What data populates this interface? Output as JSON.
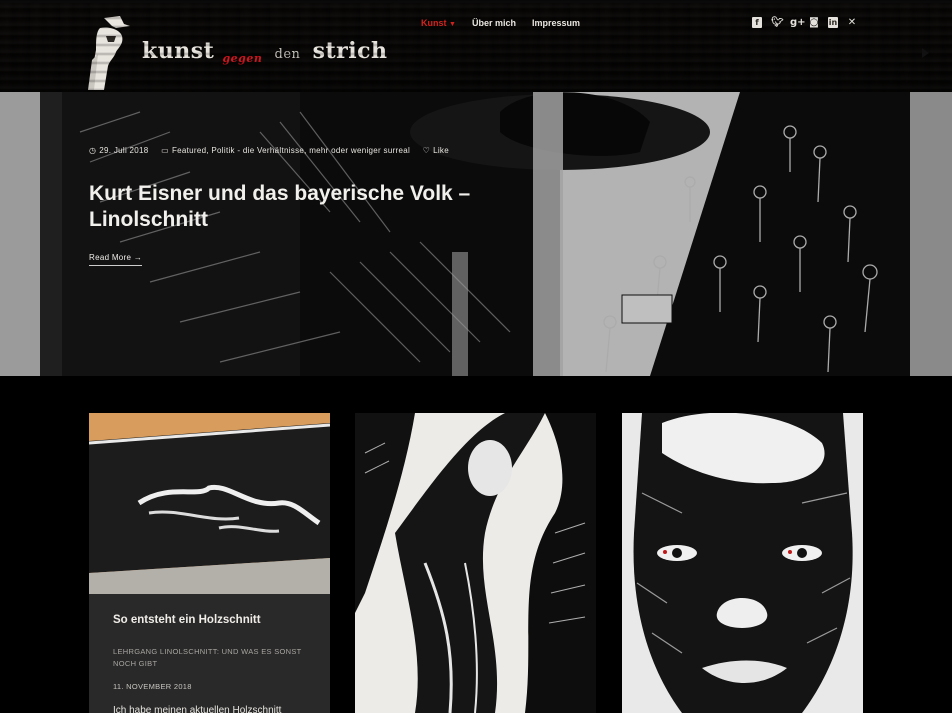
{
  "brand": {
    "word1": "kunst",
    "word2": "gegen",
    "word3": "den",
    "word4": "strich"
  },
  "nav": {
    "items": [
      {
        "label": "Kunst",
        "active": true,
        "has_dropdown": true
      },
      {
        "label": "Über mich",
        "active": false
      },
      {
        "label": "Impressum",
        "active": false
      }
    ]
  },
  "social": {
    "icons": [
      "facebook-icon",
      "twitter-icon",
      "google-plus-icon",
      "instagram-icon",
      "linkedin-icon",
      "xing-icon"
    ]
  },
  "hero": {
    "date": "29. Juli 2018",
    "categories": "Featured, Politik - die Verhältnisse, mehr oder weniger surreal",
    "like": "Like",
    "title": "Kurt Eisner und das bayerische Volk – Linolschnitt",
    "read_more": "Read More"
  },
  "posts": [
    {
      "title": "So entsteht ein Holzschnitt",
      "categories": "Lehrgang Linolschnitt: und was es sonst noch gibt",
      "date": "11. November 2018",
      "excerpt": "Ich habe meinen aktuellen Holzschnitt"
    },
    {
      "image": "woodcut-figure"
    },
    {
      "image": "woodcut-face"
    }
  ],
  "colors": {
    "accent": "#d2221d",
    "background": "#000000",
    "card": "#292929"
  }
}
